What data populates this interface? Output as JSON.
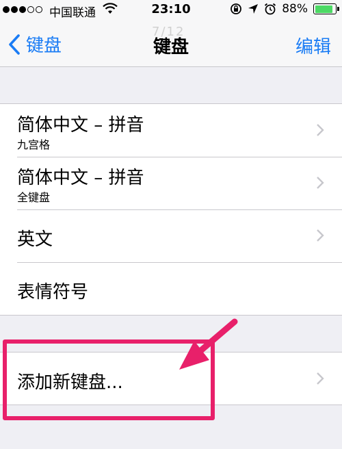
{
  "status_bar": {
    "carrier": "中国联通",
    "time": "23:10",
    "battery": "88%",
    "battery_level": 0.88,
    "signal_bars_filled": 3,
    "signal_bars_total": 5
  },
  "nav": {
    "back_label": "键盘",
    "title": "键盘",
    "edit_label": "编辑",
    "watermark": "7/12"
  },
  "keyboards": [
    {
      "title": "简体中文 – 拼音",
      "subtitle": "九宫格"
    },
    {
      "title": "简体中文 – 拼音",
      "subtitle": "全键盘"
    },
    {
      "title": "英文",
      "subtitle": ""
    },
    {
      "title": "表情符号",
      "subtitle": ""
    }
  ],
  "add_keyboard": {
    "label": "添加新键盘..."
  },
  "colors": {
    "accent": "#1a7cf5",
    "annotation": "#e8206a",
    "battery": "#4cd964",
    "background": "#efeff4"
  }
}
